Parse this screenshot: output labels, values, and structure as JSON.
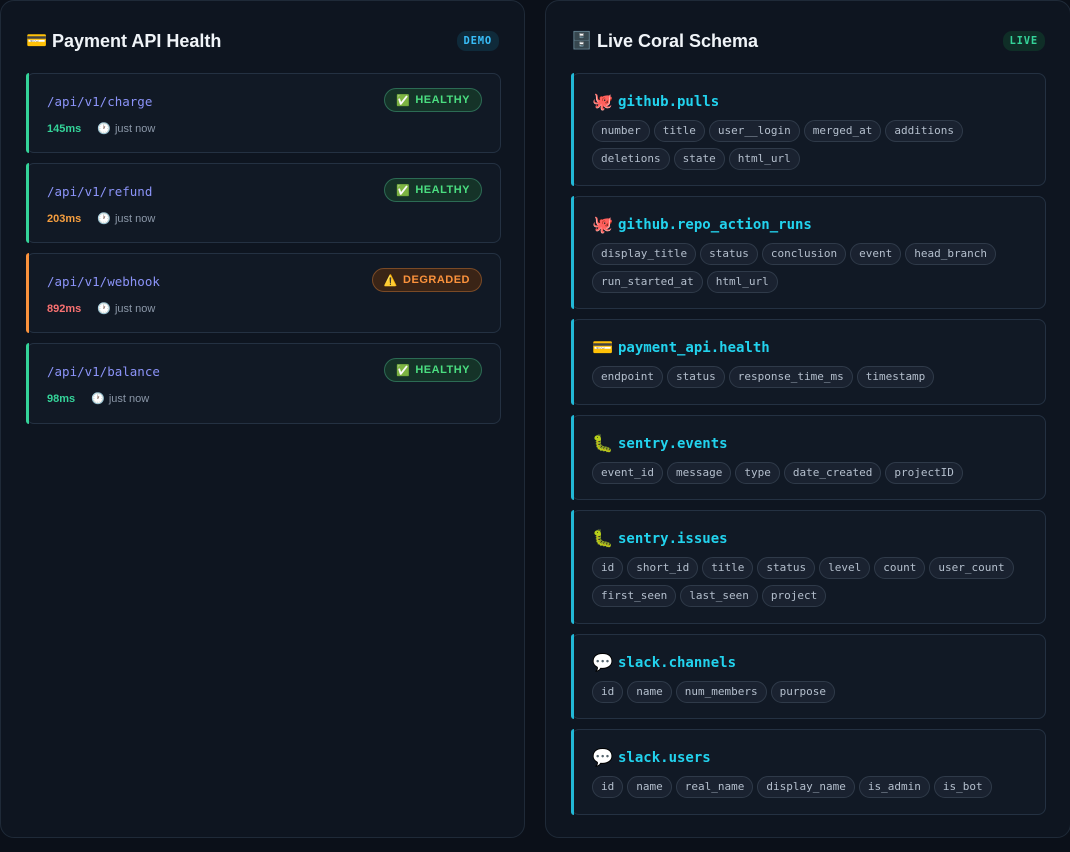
{
  "left_panel": {
    "icon": "credit-card-emoji",
    "icon_glyph": "💳",
    "title": "Payment API Health",
    "badge": "DEMO",
    "endpoints": [
      {
        "path": "/api/v1/charge",
        "status": "HEALTHY",
        "status_icon": "✅",
        "latency": "145ms",
        "time": "just now",
        "accent": "#34d399",
        "latency_color": "#34d399"
      },
      {
        "path": "/api/v1/refund",
        "status": "HEALTHY",
        "status_icon": "✅",
        "latency": "203ms",
        "time": "just now",
        "accent": "#34d399",
        "latency_color": "#f59e3f"
      },
      {
        "path": "/api/v1/webhook",
        "status": "DEGRADED",
        "status_icon": "⚠️",
        "latency": "892ms",
        "time": "just now",
        "accent": "#fb923c",
        "latency_color": "#f87171"
      },
      {
        "path": "/api/v1/balance",
        "status": "HEALTHY",
        "status_icon": "✅",
        "latency": "98ms",
        "time": "just now",
        "accent": "#34d399",
        "latency_color": "#34d399"
      }
    ]
  },
  "right_panel": {
    "icon": "file-cabinet-emoji",
    "icon_glyph": "🗄️",
    "title": "Live Coral Schema",
    "badge": "LIVE",
    "tables": [
      {
        "icon": "octopus-emoji",
        "glyph": "🐙",
        "name": "github.pulls",
        "columns": [
          "number",
          "title",
          "user__login",
          "merged_at",
          "additions",
          "deletions",
          "state",
          "html_url"
        ]
      },
      {
        "icon": "octopus-emoji",
        "glyph": "🐙",
        "name": "github.repo_action_runs",
        "columns": [
          "display_title",
          "status",
          "conclusion",
          "event",
          "head_branch",
          "run_started_at",
          "html_url"
        ]
      },
      {
        "icon": "credit-card-emoji",
        "glyph": "💳",
        "name": "payment_api.health",
        "columns": [
          "endpoint",
          "status",
          "response_time_ms",
          "timestamp"
        ]
      },
      {
        "icon": "bug-emoji",
        "glyph": "🐛",
        "name": "sentry.events",
        "columns": [
          "event_id",
          "message",
          "type",
          "date_created",
          "projectID"
        ]
      },
      {
        "icon": "bug-emoji",
        "glyph": "🐛",
        "name": "sentry.issues",
        "columns": [
          "id",
          "short_id",
          "title",
          "status",
          "level",
          "count",
          "user_count",
          "first_seen",
          "last_seen",
          "project"
        ]
      },
      {
        "icon": "speech-bubble-emoji",
        "glyph": "💬",
        "name": "slack.channels",
        "columns": [
          "id",
          "name",
          "num_members",
          "purpose"
        ]
      },
      {
        "icon": "speech-bubble-emoji",
        "glyph": "💬",
        "name": "slack.users",
        "columns": [
          "id",
          "name",
          "real_name",
          "display_name",
          "is_admin",
          "is_bot"
        ]
      }
    ]
  }
}
